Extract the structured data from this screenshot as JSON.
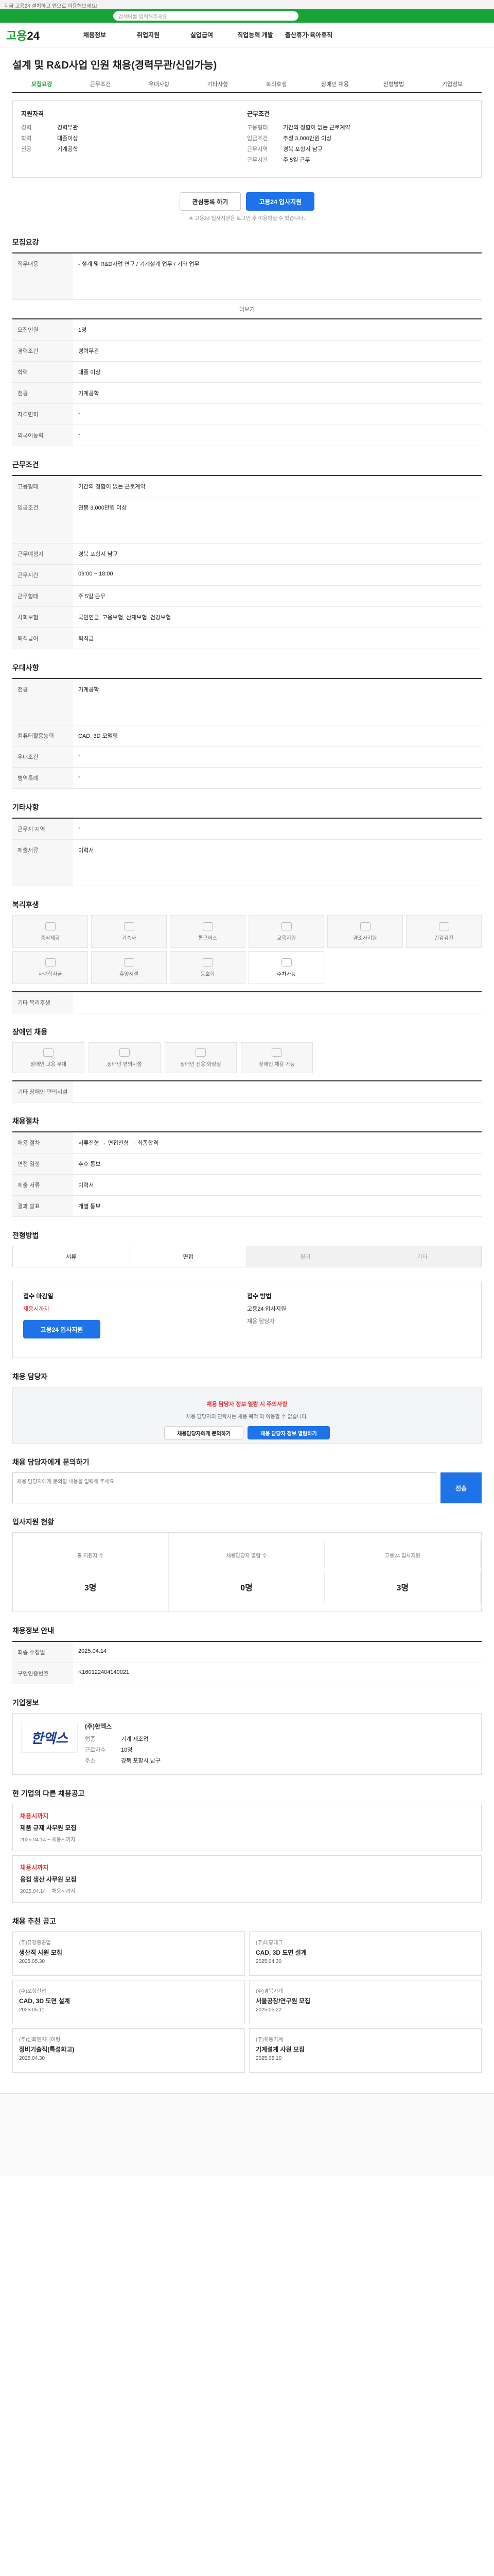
{
  "topbar": {
    "text": "지금 고용24 설치하고 앱으로 이용해보세요!"
  },
  "search": {
    "placeholder": "검색어를 입력해주세요"
  },
  "brand": {
    "logo_a": "고용",
    "logo_b": "24"
  },
  "gnb": [
    "채용정보",
    "취업지원",
    "실업급여",
    "직업능력 개발",
    "출산휴가·육아휴직"
  ],
  "job": {
    "title": "설계 및 R&D사업 인원 채용(경력무관/신입가능)"
  },
  "tabs": [
    "모집요강",
    "근무조건",
    "우대사항",
    "기타사항",
    "복리후생",
    "장애인 채용",
    "전형방법",
    "기업정보"
  ],
  "summary": {
    "left_title": "지원자격",
    "left": [
      {
        "k": "경력",
        "v": "경력무관"
      },
      {
        "k": "학력",
        "v": "대졸이상"
      },
      {
        "k": "전공",
        "v": "기계공학"
      }
    ],
    "right_title": "근무조건",
    "right": [
      {
        "k": "고용형태",
        "v": "기간의 정함이 없는 근로계약"
      },
      {
        "k": "임금조건",
        "v": "추정 3,000만원 이상"
      },
      {
        "k": "근무지역",
        "v": "경북 포항시 남구"
      },
      {
        "k": "근무시간",
        "v": "주 5일 근무"
      }
    ]
  },
  "actions": {
    "scrap": "관심등록 하기",
    "apply": "고용24 입사지원",
    "note": "※ 고용24 입사지원은 로그인 후 이용하실 수 있습니다."
  },
  "recruit": {
    "title": "모집요강",
    "rows": [
      {
        "k": "직무내용",
        "v": "- 설계 및 R&D사업 연구 / 기계설계 업무 / 기타 업무"
      },
      {
        "k": "모집인원",
        "v": "1명"
      },
      {
        "k": "경력조건",
        "v": "경력무관"
      },
      {
        "k": "학력",
        "v": "대졸 이상"
      },
      {
        "k": "전공",
        "v": "기계공학"
      },
      {
        "k": "자격면허",
        "v": "-"
      },
      {
        "k": "외국어능력",
        "v": "-"
      }
    ],
    "more": "더보기"
  },
  "work": {
    "title": "근무조건",
    "rows": [
      {
        "k": "고용형태",
        "v": "기간의 정함이 없는 근로계약"
      },
      {
        "k": "임금조건",
        "v": "연봉 3,000만원 이상"
      },
      {
        "k": "근무예정지",
        "v": "경북 포항시 남구"
      },
      {
        "k": "근무시간",
        "v": "09:00 ~ 18:00"
      },
      {
        "k": "근무형태",
        "v": "주 5일 근무"
      },
      {
        "k": "사회보험",
        "v": "국민연금, 고용보험, 산재보험, 건강보험"
      },
      {
        "k": "퇴직급여",
        "v": "퇴직금"
      }
    ]
  },
  "prefer": {
    "title": "우대사항",
    "rows": [
      {
        "k": "전공",
        "v": "기계공학"
      },
      {
        "k": "컴퓨터활용능력",
        "v": "CAD, 3D 모델링"
      },
      {
        "k": "우대조건",
        "v": "-"
      },
      {
        "k": "병역특례",
        "v": "-"
      }
    ]
  },
  "etc": {
    "title": "기타사항",
    "rows": [
      {
        "k": "근무지 지역",
        "v": "-"
      },
      {
        "k": "제출서류",
        "v": "이력서"
      }
    ]
  },
  "welfare": {
    "title": "복리후생",
    "items": [
      "중식제공",
      "기숙사",
      "통근버스",
      "교육지원",
      "경조사지원",
      "건강검진",
      "자녀학자금",
      "휴양시설",
      "동호회",
      "주차가능",
      "",
      ""
    ],
    "other_label": "기타 복리후생"
  },
  "disabled": {
    "title": "장애인 채용",
    "items": [
      "장애인 고용 우대",
      "장애인 편의시설",
      "장애인 전용 화장실",
      "장애인 채용 가능"
    ],
    "note_label": "기타 장애인 편의시설"
  },
  "process": {
    "title": "채용절차",
    "rows": [
      {
        "k": "채용 절차",
        "v": "서류전형 → 면접전형 → 최종합격"
      },
      {
        "k": "면접 일정",
        "v": "추후 통보"
      },
      {
        "k": "제출 서류",
        "v": "이력서"
      },
      {
        "k": "결과 발표",
        "v": "개별 통보"
      }
    ]
  },
  "howto": {
    "title": "전형방법",
    "items": [
      "서류",
      "면접",
      "필기",
      "기타"
    ]
  },
  "contact": {
    "left_title": "접수 마감일",
    "deadline": "채용시까지",
    "apply_btn": "고용24 입사지원",
    "right_title": "접수 방법",
    "method": "고용24 입사지원",
    "manager": "채용 담당자"
  },
  "safety": {
    "title": "채용 담당자",
    "warn": "채용 담당자 정보 열람 시 주의사항",
    "desc": "채용 담당자의 연락처는 채용 목적 외 이용할 수 없습니다.",
    "btn1": "채용담당자에게 문의하기",
    "btn2": "채용 담당자 정보 열람하기"
  },
  "inquiry": {
    "title": "채용 담당자에게 문의하기",
    "placeholder": "채용 담당자에게 문의할 내용을 입력해 주세요.",
    "send": "전송"
  },
  "status": {
    "title": "입사지원 현황",
    "items": [
      {
        "label": "총 지원자 수",
        "value": "3명"
      },
      {
        "label": "채용담당자 열람 수",
        "value": "0명"
      },
      {
        "label": "고용24 입사지원",
        "value": "3명"
      }
    ]
  },
  "info": {
    "title": "채용정보 안내",
    "rows": [
      {
        "k": "최종 수정일",
        "v": "2025.04.14"
      },
      {
        "k": "구인인증번호",
        "v": "K160122404140021"
      }
    ]
  },
  "company": {
    "title": "기업정보",
    "logo": "한엑스",
    "name": "(주)한엑스",
    "rows": [
      {
        "k": "업종",
        "v": "기계 제조업"
      },
      {
        "k": "근로자수",
        "v": "10명"
      },
      {
        "k": "주소",
        "v": "경북 포항시 남구"
      }
    ]
  },
  "other_jobs": {
    "title": "현 기업의 다른 채용공고",
    "items": [
      {
        "tag": "채용시까지",
        "title": "제품 규제 사무원 모집",
        "date": "2025.04.14 ~ 채용시까지"
      },
      {
        "tag": "채용시까지",
        "title": "용접 생산 사무원 모집",
        "date": "2025.04.14 ~ 채용시까지"
      }
    ]
  },
  "recommend": {
    "title": "채용 추천 공고",
    "items": [
      {
        "company": "(주)유창중공업",
        "title": "생산직 사원 모집",
        "date": "2025.05.30"
      },
      {
        "company": "(주)대흥테크",
        "title": "CAD, 3D 도면 설계",
        "date": "2025.04.30"
      },
      {
        "company": "(주)포항산업",
        "title": "CAD, 3D 도면 설계",
        "date": "2025.05.11"
      },
      {
        "company": "(주)경북기계",
        "title": "서울공장/연구원 모집",
        "date": "2025.05.22"
      },
      {
        "company": "(주)신화엔지니어링",
        "title": "정비기술직(특성화고)",
        "date": "2025.04.30"
      },
      {
        "company": "(주)해동기계",
        "title": "기계설계 사원 모집",
        "date": "2025.05.10"
      }
    ]
  }
}
